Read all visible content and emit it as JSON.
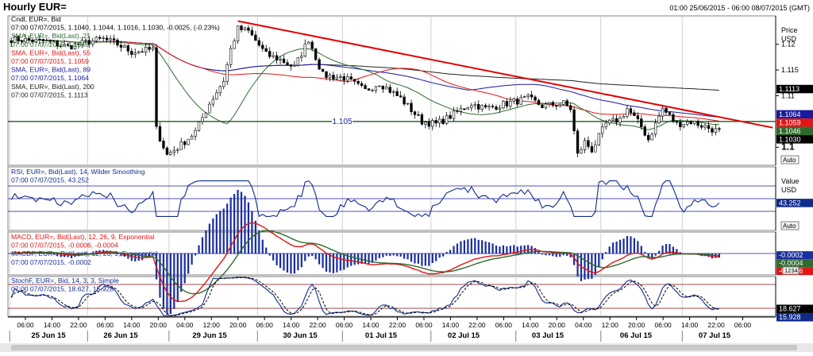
{
  "header": {
    "title": "Hourly EUR=",
    "range": "01:00 25/06/2015 - 06:00 08/07/2015 (GMT)"
  },
  "colors": {
    "price": "#000000",
    "sma21": "#2e6b2e",
    "sma55": "#e31414",
    "sma89": "#1a1a9e",
    "sma200": "#222222",
    "trend": "#e30000",
    "level": "#0a4a0a",
    "rsi": "#102a8c",
    "macd": "#e31414",
    "macdf": "#2e6b2e",
    "hist": "#1a2f9e",
    "stoch_k": "#102a8c",
    "stoch_d": "#000000"
  },
  "legend": {
    "main": [
      {
        "text": "Cndl, EUR=, Bid",
        "color": "#000000"
      },
      {
        "text": "07:00 07/07/2015, 1.1040, 1.1044, 1.1016, 1.1030, -0.0025, (-0.23%)",
        "color": "#000000"
      },
      {
        "text": "SMA, EUR=, Bid(Last), 21",
        "color": "#2e6b2e"
      },
      {
        "text": "07:00 07/07/2015, 1.1046",
        "color": "#2e6b2e"
      },
      {
        "text": "SMA, EUR=, Bid(Last), 55",
        "color": "#e31414"
      },
      {
        "text": "07:00 07/07/2015, 1.1059",
        "color": "#e31414"
      },
      {
        "text": "SMA, EUR=, Bid(Last), 89",
        "color": "#1a1a9e"
      },
      {
        "text": "07:00 07/07/2015, 1.1064",
        "color": "#1a1a9e"
      },
      {
        "text": "SMA, EUR=, Bid(Last), 200",
        "color": "#222222"
      },
      {
        "text": "07:00 07/07/2015, 1.1113",
        "color": "#222222"
      }
    ],
    "rsi": [
      {
        "text": "RSI, EUR=, Bid(Last), 14, Wilder Smoothing",
        "color": "#102a8c"
      },
      {
        "text": "07:00 07/07/2015, 43.252",
        "color": "#102a8c"
      }
    ],
    "macd": [
      {
        "text": "MACD, EUR=, Bid(Last), 12, 26, 9, Exponential",
        "color": "#e31414"
      },
      {
        "text": "07:00 07/07/2015, -0.0006, -0.0004",
        "color": "#e31414"
      },
      {
        "text": "MACDF, EUR=, Bid(Last), 12, 26, 9, Exponential",
        "color": "#1a2f9e"
      },
      {
        "text": "07:00 07/07/2015, -0.0002",
        "color": "#1a2f9e"
      }
    ],
    "stoch": [
      {
        "text": "StochF, EUR=, Bid, 14, 3, 3, Simple",
        "color": "#102a8c"
      },
      {
        "text": "07:00 07/07/2015, 18.627, 15.928",
        "color": "#102a8c"
      }
    ]
  },
  "axes": {
    "price_title": "Price",
    "price_unit": "USD",
    "value_title": "Value",
    "value_unit": "USD",
    "auto": "Auto",
    "macd_box": "1234"
  },
  "level_label": "1.105",
  "price_ticks": [
    {
      "v": 1.12,
      "label": "1.12",
      "bold": false
    },
    {
      "v": 1.115,
      "label": "1.115",
      "bold": false
    },
    {
      "v": 1.11,
      "label": "1.11",
      "bold": false
    },
    {
      "v": 1.1,
      "label": "1.1",
      "bold": true
    }
  ],
  "price_tags": [
    {
      "v": 1.1113,
      "label": "1.1113",
      "bg": "#000000",
      "fg": "#ffffff"
    },
    {
      "v": 1.1064,
      "label": "1.1064",
      "bg": "#1a1a9e",
      "fg": "#ffffff"
    },
    {
      "v": 1.1059,
      "label": "1.1059",
      "bg": "#e31414",
      "fg": "#ffffff"
    },
    {
      "v": 1.1046,
      "label": "1.1046",
      "bg": "#2e6b2e",
      "fg": "#ffffff"
    },
    {
      "v": 1.103,
      "label": "1.1030",
      "bg": "#000000",
      "fg": "#ffffff"
    }
  ],
  "rsi_tags": [
    {
      "v": 43.252,
      "label": "43.252",
      "bg": "#102a8c",
      "fg": "#ffffff"
    }
  ],
  "macd_tags": [
    {
      "v": -0.0002,
      "label": "-0.0002",
      "bg": "#1a2f9e",
      "fg": "#ffffff"
    },
    {
      "v": -0.0004,
      "label": "-0.0004",
      "bg": "#2e6b2e",
      "fg": "#ffffff"
    },
    {
      "v": -0.0006,
      "label": "-0.0006",
      "bg": "#e31414",
      "fg": "#ffffff"
    }
  ],
  "stoch_tags": [
    {
      "v": 18.627,
      "label": "18.627",
      "bg": "#000000",
      "fg": "#ffffff"
    },
    {
      "v": 15.928,
      "label": "15.928",
      "bg": "#102a8c",
      "fg": "#ffffff"
    }
  ],
  "time_axis": {
    "hour_labels": [
      "06:00",
      "14:00",
      "22:00",
      "06:00",
      "14:00",
      "20:00",
      "04:00",
      "12:00",
      "20:00",
      "06:00",
      "14:00",
      "22:00",
      "06:00",
      "14:00",
      "22:00",
      "06:00",
      "14:00",
      "22:00",
      "06:00",
      "14:00",
      "20:00",
      "04:00",
      "12:00",
      "20:00",
      "06:00",
      "14:00",
      "22:00",
      "06:00"
    ],
    "day_labels": [
      "25 Jun 15",
      "26 Jun 15",
      "29 Jun 15",
      "30 Jun 15",
      "01 Jul 15",
      "02 Jul 15",
      "03 Jul 15",
      "06 Jul 15",
      "07 Jul 15"
    ]
  },
  "chart_data": {
    "type": "line",
    "title": "Hourly EUR=",
    "x_note": "hourly bars 25 Jun 2015 - 07 Jul 2015",
    "price_range": [
      1.0965,
      1.1255
    ],
    "rsi_range": [
      0,
      100
    ],
    "macd_range": [
      -0.0025,
      0.0025
    ],
    "stoch_range": [
      0,
      100
    ],
    "price_keypoints": [
      {
        "i": 0,
        "v": 1.121
      },
      {
        "i": 10,
        "v": 1.1205
      },
      {
        "i": 16,
        "v": 1.1195
      },
      {
        "i": 22,
        "v": 1.1205
      },
      {
        "i": 26,
        "v": 1.121
      },
      {
        "i": 30,
        "v": 1.12
      },
      {
        "i": 34,
        "v": 1.1185
      },
      {
        "i": 40,
        "v": 1.119
      },
      {
        "i": 41,
        "v": 1.1035
      },
      {
        "i": 44,
        "v": 1.0985
      },
      {
        "i": 48,
        "v": 1.1005
      },
      {
        "i": 52,
        "v": 1.103
      },
      {
        "i": 56,
        "v": 1.1085
      },
      {
        "i": 60,
        "v": 1.113
      },
      {
        "i": 62,
        "v": 1.119
      },
      {
        "i": 64,
        "v": 1.123
      },
      {
        "i": 67,
        "v": 1.1225
      },
      {
        "i": 72,
        "v": 1.118
      },
      {
        "i": 76,
        "v": 1.117
      },
      {
        "i": 80,
        "v": 1.1155
      },
      {
        "i": 84,
        "v": 1.121
      },
      {
        "i": 88,
        "v": 1.114
      },
      {
        "i": 94,
        "v": 1.1135
      },
      {
        "i": 100,
        "v": 1.111
      },
      {
        "i": 104,
        "v": 1.1125
      },
      {
        "i": 110,
        "v": 1.1095
      },
      {
        "i": 116,
        "v": 1.105
      },
      {
        "i": 120,
        "v": 1.1045
      },
      {
        "i": 124,
        "v": 1.106
      },
      {
        "i": 130,
        "v": 1.1085
      },
      {
        "i": 134,
        "v": 1.1075
      },
      {
        "i": 140,
        "v": 1.1085
      },
      {
        "i": 146,
        "v": 1.1095
      },
      {
        "i": 150,
        "v": 1.108
      },
      {
        "i": 156,
        "v": 1.1085
      },
      {
        "i": 158,
        "v": 1.1075
      },
      {
        "i": 160,
        "v": 1.0985
      },
      {
        "i": 162,
        "v": 1.101
      },
      {
        "i": 164,
        "v": 1.0995
      },
      {
        "i": 168,
        "v": 1.1045
      },
      {
        "i": 172,
        "v": 1.1055
      },
      {
        "i": 174,
        "v": 1.1075
      },
      {
        "i": 178,
        "v": 1.104
      },
      {
        "i": 180,
        "v": 1.1015
      },
      {
        "i": 184,
        "v": 1.1075
      },
      {
        "i": 188,
        "v": 1.1045
      },
      {
        "i": 192,
        "v": 1.105
      },
      {
        "i": 198,
        "v": 1.1035
      },
      {
        "i": 200,
        "v": 1.103
      }
    ],
    "series": [
      {
        "name": "Cndl, EUR=, Bid",
        "last": 1.103
      },
      {
        "name": "SMA, EUR=, Bid(Last), 21",
        "last": 1.1046
      },
      {
        "name": "SMA, EUR=, Bid(Last), 55",
        "last": 1.1059
      },
      {
        "name": "SMA, EUR=, Bid(Last), 89",
        "last": 1.1064
      },
      {
        "name": "SMA, EUR=, Bid(Last), 200",
        "last": 1.1113
      }
    ],
    "horizontal_level": 1.105,
    "trendline": {
      "from": {
        "i": 64,
        "v": 1.1245
      },
      "to": {
        "i": 212,
        "v": 1.1038
      }
    },
    "indicators": {
      "rsi": {
        "last": 43.252,
        "bands": [
          30,
          50,
          70
        ]
      },
      "macd": {
        "macd": -0.0006,
        "signal": -0.0004,
        "hist": -0.0002
      },
      "stoch": {
        "k": 18.627,
        "d": 15.928
      }
    }
  }
}
